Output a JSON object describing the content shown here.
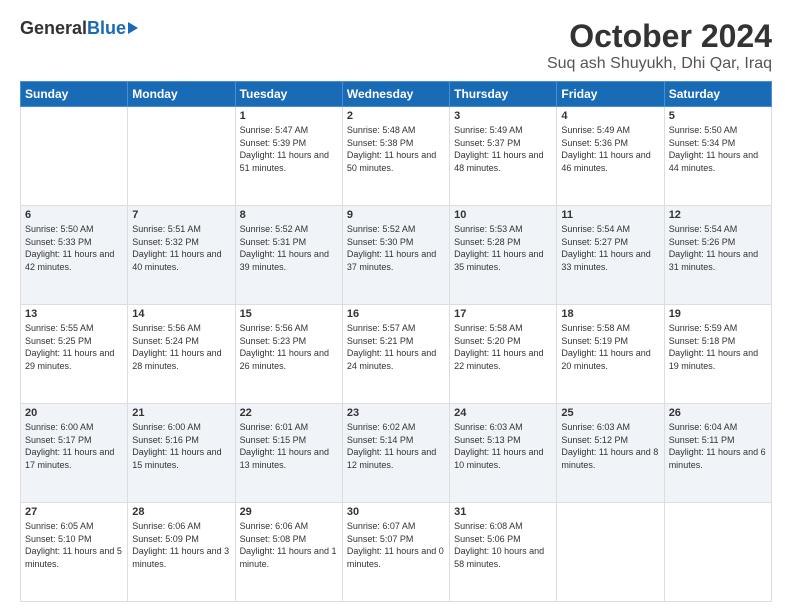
{
  "header": {
    "logo_general": "General",
    "logo_blue": "Blue",
    "title": "October 2024",
    "subtitle": "Suq ash Shuyukh, Dhi Qar, Iraq"
  },
  "days_of_week": [
    "Sunday",
    "Monday",
    "Tuesday",
    "Wednesday",
    "Thursday",
    "Friday",
    "Saturday"
  ],
  "weeks": [
    [
      {
        "day": "",
        "info": ""
      },
      {
        "day": "",
        "info": ""
      },
      {
        "day": "1",
        "info": "Sunrise: 5:47 AM\nSunset: 5:39 PM\nDaylight: 11 hours and 51 minutes."
      },
      {
        "day": "2",
        "info": "Sunrise: 5:48 AM\nSunset: 5:38 PM\nDaylight: 11 hours and 50 minutes."
      },
      {
        "day": "3",
        "info": "Sunrise: 5:49 AM\nSunset: 5:37 PM\nDaylight: 11 hours and 48 minutes."
      },
      {
        "day": "4",
        "info": "Sunrise: 5:49 AM\nSunset: 5:36 PM\nDaylight: 11 hours and 46 minutes."
      },
      {
        "day": "5",
        "info": "Sunrise: 5:50 AM\nSunset: 5:34 PM\nDaylight: 11 hours and 44 minutes."
      }
    ],
    [
      {
        "day": "6",
        "info": "Sunrise: 5:50 AM\nSunset: 5:33 PM\nDaylight: 11 hours and 42 minutes."
      },
      {
        "day": "7",
        "info": "Sunrise: 5:51 AM\nSunset: 5:32 PM\nDaylight: 11 hours and 40 minutes."
      },
      {
        "day": "8",
        "info": "Sunrise: 5:52 AM\nSunset: 5:31 PM\nDaylight: 11 hours and 39 minutes."
      },
      {
        "day": "9",
        "info": "Sunrise: 5:52 AM\nSunset: 5:30 PM\nDaylight: 11 hours and 37 minutes."
      },
      {
        "day": "10",
        "info": "Sunrise: 5:53 AM\nSunset: 5:28 PM\nDaylight: 11 hours and 35 minutes."
      },
      {
        "day": "11",
        "info": "Sunrise: 5:54 AM\nSunset: 5:27 PM\nDaylight: 11 hours and 33 minutes."
      },
      {
        "day": "12",
        "info": "Sunrise: 5:54 AM\nSunset: 5:26 PM\nDaylight: 11 hours and 31 minutes."
      }
    ],
    [
      {
        "day": "13",
        "info": "Sunrise: 5:55 AM\nSunset: 5:25 PM\nDaylight: 11 hours and 29 minutes."
      },
      {
        "day": "14",
        "info": "Sunrise: 5:56 AM\nSunset: 5:24 PM\nDaylight: 11 hours and 28 minutes."
      },
      {
        "day": "15",
        "info": "Sunrise: 5:56 AM\nSunset: 5:23 PM\nDaylight: 11 hours and 26 minutes."
      },
      {
        "day": "16",
        "info": "Sunrise: 5:57 AM\nSunset: 5:21 PM\nDaylight: 11 hours and 24 minutes."
      },
      {
        "day": "17",
        "info": "Sunrise: 5:58 AM\nSunset: 5:20 PM\nDaylight: 11 hours and 22 minutes."
      },
      {
        "day": "18",
        "info": "Sunrise: 5:58 AM\nSunset: 5:19 PM\nDaylight: 11 hours and 20 minutes."
      },
      {
        "day": "19",
        "info": "Sunrise: 5:59 AM\nSunset: 5:18 PM\nDaylight: 11 hours and 19 minutes."
      }
    ],
    [
      {
        "day": "20",
        "info": "Sunrise: 6:00 AM\nSunset: 5:17 PM\nDaylight: 11 hours and 17 minutes."
      },
      {
        "day": "21",
        "info": "Sunrise: 6:00 AM\nSunset: 5:16 PM\nDaylight: 11 hours and 15 minutes."
      },
      {
        "day": "22",
        "info": "Sunrise: 6:01 AM\nSunset: 5:15 PM\nDaylight: 11 hours and 13 minutes."
      },
      {
        "day": "23",
        "info": "Sunrise: 6:02 AM\nSunset: 5:14 PM\nDaylight: 11 hours and 12 minutes."
      },
      {
        "day": "24",
        "info": "Sunrise: 6:03 AM\nSunset: 5:13 PM\nDaylight: 11 hours and 10 minutes."
      },
      {
        "day": "25",
        "info": "Sunrise: 6:03 AM\nSunset: 5:12 PM\nDaylight: 11 hours and 8 minutes."
      },
      {
        "day": "26",
        "info": "Sunrise: 6:04 AM\nSunset: 5:11 PM\nDaylight: 11 hours and 6 minutes."
      }
    ],
    [
      {
        "day": "27",
        "info": "Sunrise: 6:05 AM\nSunset: 5:10 PM\nDaylight: 11 hours and 5 minutes."
      },
      {
        "day": "28",
        "info": "Sunrise: 6:06 AM\nSunset: 5:09 PM\nDaylight: 11 hours and 3 minutes."
      },
      {
        "day": "29",
        "info": "Sunrise: 6:06 AM\nSunset: 5:08 PM\nDaylight: 11 hours and 1 minute."
      },
      {
        "day": "30",
        "info": "Sunrise: 6:07 AM\nSunset: 5:07 PM\nDaylight: 11 hours and 0 minutes."
      },
      {
        "day": "31",
        "info": "Sunrise: 6:08 AM\nSunset: 5:06 PM\nDaylight: 10 hours and 58 minutes."
      },
      {
        "day": "",
        "info": ""
      },
      {
        "day": "",
        "info": ""
      }
    ]
  ]
}
